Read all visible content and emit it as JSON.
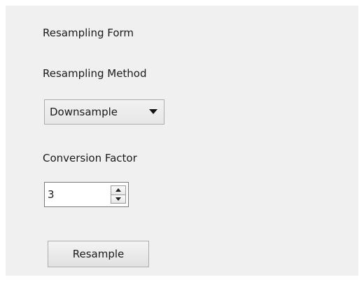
{
  "form": {
    "title": "Resampling Form",
    "method_label": "Resampling Method",
    "method_value": "Downsample",
    "factor_label": "Conversion Factor",
    "factor_value": "3",
    "button_label": "Resample"
  },
  "icons": {
    "combo_arrow": "triangle-down",
    "spin_up": "triangle-up",
    "spin_down": "triangle-down"
  }
}
